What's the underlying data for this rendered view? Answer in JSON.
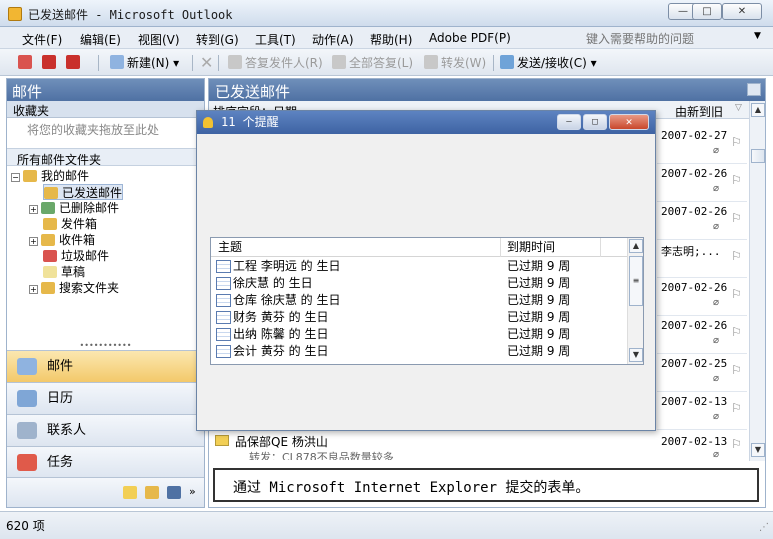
{
  "window": {
    "title": "已发送邮件 - Microsoft Outlook",
    "minimize": "—",
    "restore": "□",
    "close": "✕"
  },
  "menu": {
    "items": [
      "文件(F)",
      "编辑(E)",
      "视图(V)",
      "转到(G)",
      "工具(T)",
      "动作(A)",
      "帮助(H)",
      "Adobe PDF(P)"
    ],
    "help_placeholder": "键入需要帮助的问题"
  },
  "toolbar": {
    "new_label": "新建(N)",
    "reply_label": "答复发件人(R)",
    "reply_all_label": "全部答复(L)",
    "forward_label": "转发(W)",
    "send_receive_label": "发送/接收(C)"
  },
  "navigation": {
    "header": "邮件",
    "favorites_label": "收藏夹",
    "favorites_hint": "将您的收藏夹拖放至此处",
    "all_folders_label": "所有邮件文件夹",
    "root_label": "我的邮件",
    "folders": [
      "已发送邮件",
      "已删除邮件",
      "发件箱",
      "收件箱",
      "垃圾邮件",
      "草稿",
      "搜索文件夹"
    ],
    "buttons": [
      "邮件",
      "日历",
      "联系人",
      "任务"
    ]
  },
  "list": {
    "header": "已发送邮件",
    "sort_label": "排序字段：日期",
    "order_label": "由新到旧",
    "dates": [
      "2007-02-27",
      "2007-02-26",
      "2007-02-26",
      "李志明;...",
      "2007-02-26",
      "2007-02-26",
      "2007-02-25",
      "2007-02-13"
    ],
    "bottom_item": {
      "subject": "品保部QE 杨洪山",
      "preview": "转发：CL878不良品数量较多",
      "date": "2007-02-13"
    },
    "reading_banner": "通过 Microsoft Internet Explorer 提交的表单。"
  },
  "reminders": {
    "title": "11 个提醒",
    "col_subject": "主题",
    "col_due": "到期时间",
    "items": [
      {
        "subject": "工程 李明远 的 生日",
        "due": "已过期 9 周"
      },
      {
        "subject": "徐庆慧 的 生日",
        "due": "已过期 9 周"
      },
      {
        "subject": "仓库 徐庆慧 的 生日",
        "due": "已过期 9 周"
      },
      {
        "subject": "财务 黄芬 的 生日",
        "due": "已过期 9 周"
      },
      {
        "subject": "出纳 陈馨 的 生日",
        "due": "已过期 9 周"
      },
      {
        "subject": "会计 黄芬 的 生日",
        "due": "已过期 9 周"
      }
    ]
  },
  "status": {
    "count_label": "620 项"
  }
}
